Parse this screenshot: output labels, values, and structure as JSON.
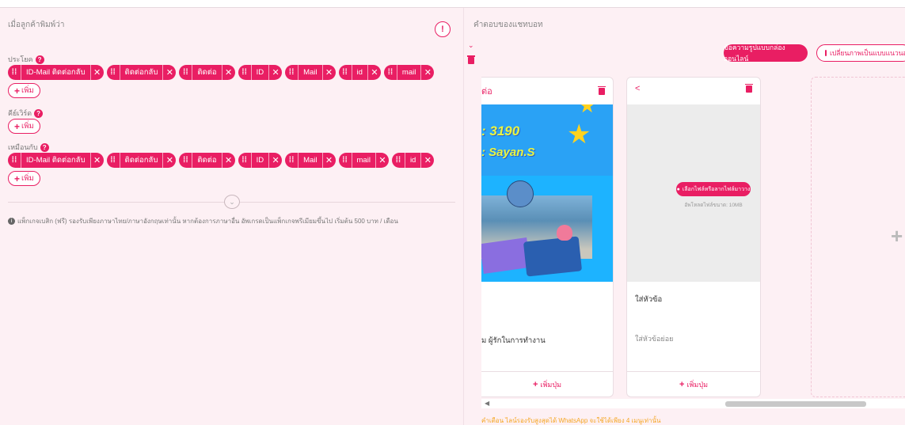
{
  "left_panel": {
    "title": "เมื่อลูกค้าพิมพ์ว่า",
    "info_icon": "!",
    "groups": [
      {
        "label": "ประโยค",
        "chips": [
          "ID-Mail ติดต่อกลับ",
          "ติดต่อกลับ",
          "ติดต่อ",
          "ID",
          "Mail",
          "id",
          "mail"
        ],
        "add_label": "เพิ่ม"
      },
      {
        "label": "คีย์เวิร์ด",
        "chips": [],
        "add_label": "เพิ่ม"
      },
      {
        "label": "เหมือนกับ",
        "chips": [
          "ID-Mail ติดต่อกลับ",
          "ติดต่อกลับ",
          "ติดต่อ",
          "ID",
          "Mail",
          "mail",
          "id"
        ],
        "add_label": "เพิ่ม"
      }
    ],
    "note": "แพ็กเกจเบสิก (ฟรี) รองรับเพียงภาษาไทย/ภาษาอังกฤษเท่านั้น หากต้องการภาษาอื่น อัพเกรดเป็นแพ็กเกจพรีเมียมขึ้นไป เริ่มต้น 500 บาท / เดือน"
  },
  "right_panel": {
    "title": "คำตอบของแชทบอท",
    "primary_button": "ข้อความรูปแบบกล่องออนไลน์",
    "secondary_button": "เปลี่ยนภาพเป็นแบบแนวนอน",
    "cards": [
      {
        "head": "ต่อ",
        "image_text_1": ": 3190",
        "image_text_2": ": Sayan.S",
        "body": "ม ผู้รักในการทำงาน",
        "add_button": "เพิ่มปุ่ม"
      },
      {
        "head": "<",
        "upload_button": "เลือกไฟล์หรือลากไฟล์มาวาง",
        "upload_hint": "อัพโหลดไฟล์ขนาด: 10MB",
        "title": "ใส่หัวข้อ",
        "subtitle": "ใส่หัวข้อย่อย",
        "add_button": "เพิ่มปุ่ม"
      }
    ],
    "new_card_icon": "+",
    "warning": "คำเตือน ไลน์รองรับสูงสุดได้ WhatsApp จะใช้ได้เพียง 4 เมนูเท่านั้น"
  },
  "colors": {
    "accent": "#e91e63",
    "background": "#fdf0f4",
    "warning": "#f5a623"
  }
}
